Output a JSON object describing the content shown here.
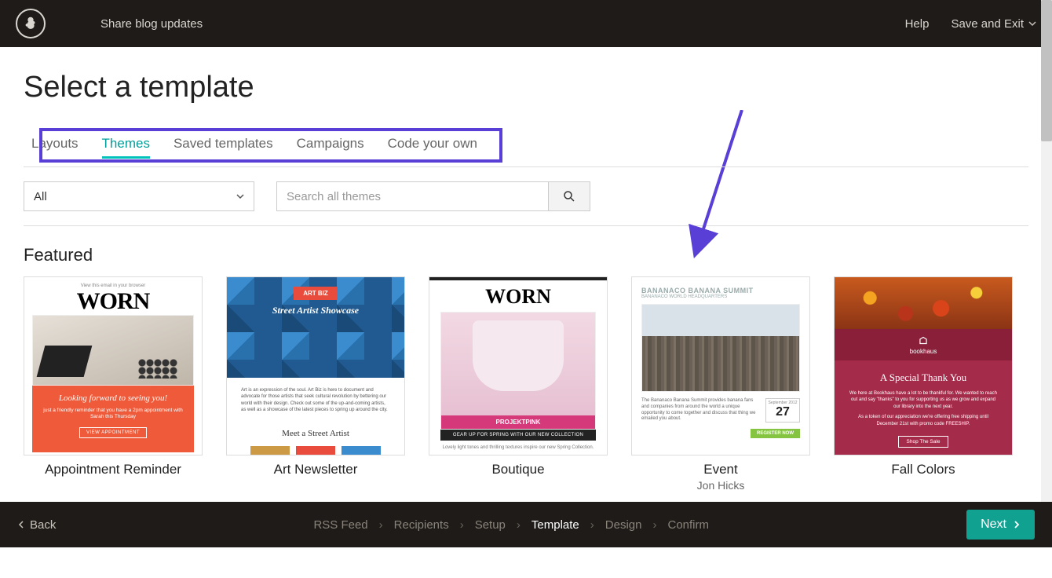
{
  "header": {
    "campaign_name": "Share blog updates",
    "help_label": "Help",
    "save_exit_label": "Save and Exit"
  },
  "page_title": "Select a template",
  "tabs": [
    {
      "label": "Layouts",
      "active": false
    },
    {
      "label": "Themes",
      "active": true
    },
    {
      "label": "Saved templates",
      "active": false
    },
    {
      "label": "Campaigns",
      "active": false
    },
    {
      "label": "Code your own",
      "active": false
    }
  ],
  "filter": {
    "dropdown_value": "All",
    "search_placeholder": "Search all themes"
  },
  "section_title": "Featured",
  "templates": [
    {
      "name": "Appointment Reminder",
      "author": "",
      "brand_text": "WORN",
      "preview_line": "View this email in your browser",
      "hero_headline": "Looking forward to seeing you!",
      "hero_sub": "just a friendly reminder that you have a 2pm appointment with Sarah this Thursday",
      "cta": "VIEW APPOINTMENT"
    },
    {
      "name": "Art Newsletter",
      "author": "",
      "badge": "ART BIZ",
      "headline": "Street Artist Showcase",
      "body_excerpt": "Art is an expression of the soul. Art Biz is here to document and advocate for those artists that seek cultural revolution by bettering our world with their design. Check out some of the up-and-coming artists, as well as a showcase of the latest pieces to spring up around the city.",
      "sub_head": "Meet a Street Artist"
    },
    {
      "name": "Boutique",
      "author": "",
      "brand_text": "WORN",
      "photo_label": "PROJEKTPINK",
      "strip": "GEAR UP FOR SPRING WITH OUR NEW COLLECTION",
      "caption": "Lovely light tones and thrilling textures inspire our new Spring Collection."
    },
    {
      "name": "Event",
      "author": "Jon Hicks",
      "title": "BANANACO BANANA SUMMIT",
      "subtitle": "BANANACO WORLD HEADQUARTERS",
      "body": "The Bananaco Banana Summit provides banana fans and companies from around the world a unique opportunity to come together and discuss that thing we emailed you about.",
      "date_month": "September 2012",
      "date_day": "27",
      "cta": "REGISTER NOW"
    },
    {
      "name": "Fall Colors",
      "author": "",
      "brand": "bookhaus",
      "headline": "A Special Thank You",
      "p1": "We here at Bookhaus have a lot to be thankful for. We wanted to reach out and say \"thanks\" to you for supporting us as we grow and expand our library into the next year.",
      "p2": "As a token of our appreciation we're offering free shipping until December 21st with promo code FREESHIP.",
      "cta": "Shop The Sale"
    }
  ],
  "footer": {
    "back_label": "Back",
    "next_label": "Next",
    "steps": [
      {
        "label": "RSS Feed",
        "active": false
      },
      {
        "label": "Recipients",
        "active": false
      },
      {
        "label": "Setup",
        "active": false
      },
      {
        "label": "Template",
        "active": true
      },
      {
        "label": "Design",
        "active": false
      },
      {
        "label": "Confirm",
        "active": false
      }
    ]
  }
}
